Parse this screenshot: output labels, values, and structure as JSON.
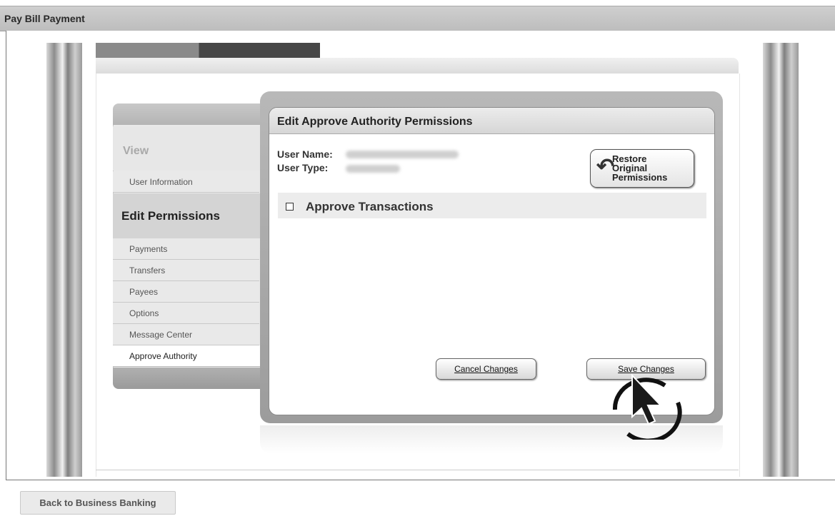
{
  "window": {
    "title": "Pay Bill Payment"
  },
  "sidebar": {
    "view_heading": "View",
    "view_items": [
      {
        "label": "User Information"
      }
    ],
    "edit_heading": "Edit Permissions",
    "edit_items": [
      {
        "label": "Payments"
      },
      {
        "label": "Transfers"
      },
      {
        "label": "Payees"
      },
      {
        "label": "Options"
      },
      {
        "label": "Message Center"
      },
      {
        "label": "Approve Authority",
        "active": true
      }
    ]
  },
  "panel": {
    "title": "Edit Approve Authority Permissions",
    "user_name_label": "User Name:",
    "user_type_label": "User Type:",
    "restore_button": {
      "line1": "Restore",
      "line2": "Original",
      "line3": "Permissions"
    },
    "permission": {
      "label": "Approve Transactions",
      "checked": false
    },
    "cancel_button": "Cancel Changes",
    "save_button": "Save Changes"
  },
  "footer": {
    "back_button": "Back to Business Banking"
  }
}
